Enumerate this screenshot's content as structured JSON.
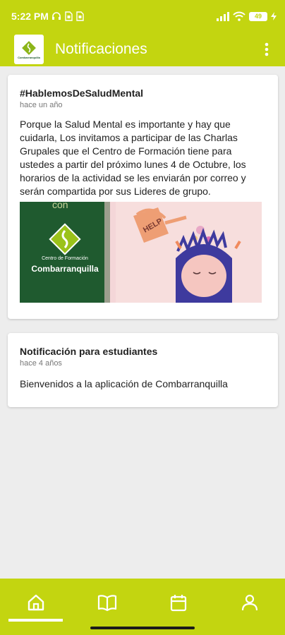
{
  "status_bar": {
    "time": "5:22 PM",
    "battery": "49"
  },
  "app_bar": {
    "title": "Notificaciones",
    "logo_text": "Combarranquilla"
  },
  "notifications": [
    {
      "title": "#HablemosDeSaludMental",
      "time": "hace un año",
      "body": "Porque la Salud Mental es importante y hay que cuidarla, Los invitamos a participar de las Charlas Grupales que el Centro de Formación tiene para ustedes a partir del próximo lunes 4 de Octubre, los horarios de la actividad se les enviarán por correo y serán compartida por sus Lideres de grupo.",
      "image": {
        "top_text": "con",
        "center_line1": "Centro de Formación",
        "center_line2": "Combarranquilla",
        "can_text": "HELP"
      }
    },
    {
      "title": "Notificación para estudiantes",
      "time": "hace 4 años",
      "body": "Bienvenidos a la aplicación de Combarranquilla"
    }
  ],
  "bottom_nav": [
    {
      "icon": "home-icon",
      "active": true
    },
    {
      "icon": "book-icon",
      "active": false
    },
    {
      "icon": "calendar-icon",
      "active": false
    },
    {
      "icon": "profile-icon",
      "active": false
    }
  ],
  "colors": {
    "accent": "#c3d510",
    "background": "#ededed",
    "card": "#ffffff",
    "image_green": "#1f5a2f"
  }
}
